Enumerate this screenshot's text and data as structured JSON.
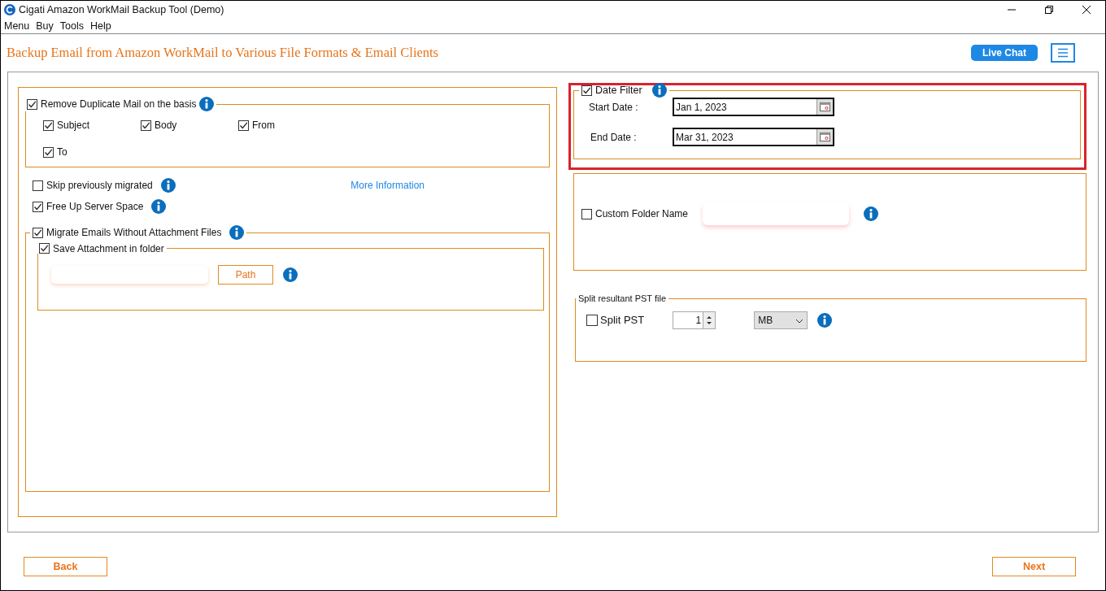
{
  "window": {
    "title": "Cigati Amazon WorkMail Backup Tool (Demo)"
  },
  "menu": [
    {
      "label": "Menu"
    },
    {
      "label": "Buy"
    },
    {
      "label": "Tools"
    },
    {
      "label": "Help"
    }
  ],
  "header": {
    "title": "Backup Email from Amazon WorkMail to Various File Formats & Email Clients",
    "live_chat": "Live Chat"
  },
  "remove_duplicates": {
    "label": "Remove Duplicate Mail on the basis",
    "checked": true,
    "options": [
      {
        "label": "Subject",
        "checked": true
      },
      {
        "label": "Body",
        "checked": true
      },
      {
        "label": "From",
        "checked": true
      },
      {
        "label": "To",
        "checked": true
      }
    ]
  },
  "options": [
    {
      "label": "Skip previously migrated",
      "checked": false
    },
    {
      "label": "Free Up Server Space",
      "checked": true
    }
  ],
  "more_information": "More Information",
  "migrate_without_attachments": {
    "label": "Migrate Emails Without Attachment Files",
    "checked": true
  },
  "save_attachment": {
    "label": "Save Attachment in folder",
    "checked": true,
    "path_button": "Path"
  },
  "date_filter": {
    "label": "Date Filter",
    "checked": true,
    "start_label": "Start Date :",
    "start_value": "Jan 1, 2023",
    "end_label": "End Date :",
    "end_value": "Mar 31, 2023"
  },
  "custom_folder": {
    "label": "Custom Folder Name",
    "checked": false
  },
  "split": {
    "title": "Split resultant PST file",
    "label": "Split PST",
    "checked": false,
    "size": "1",
    "unit": "MB"
  },
  "footer": {
    "back": "Back",
    "next": "Next"
  }
}
